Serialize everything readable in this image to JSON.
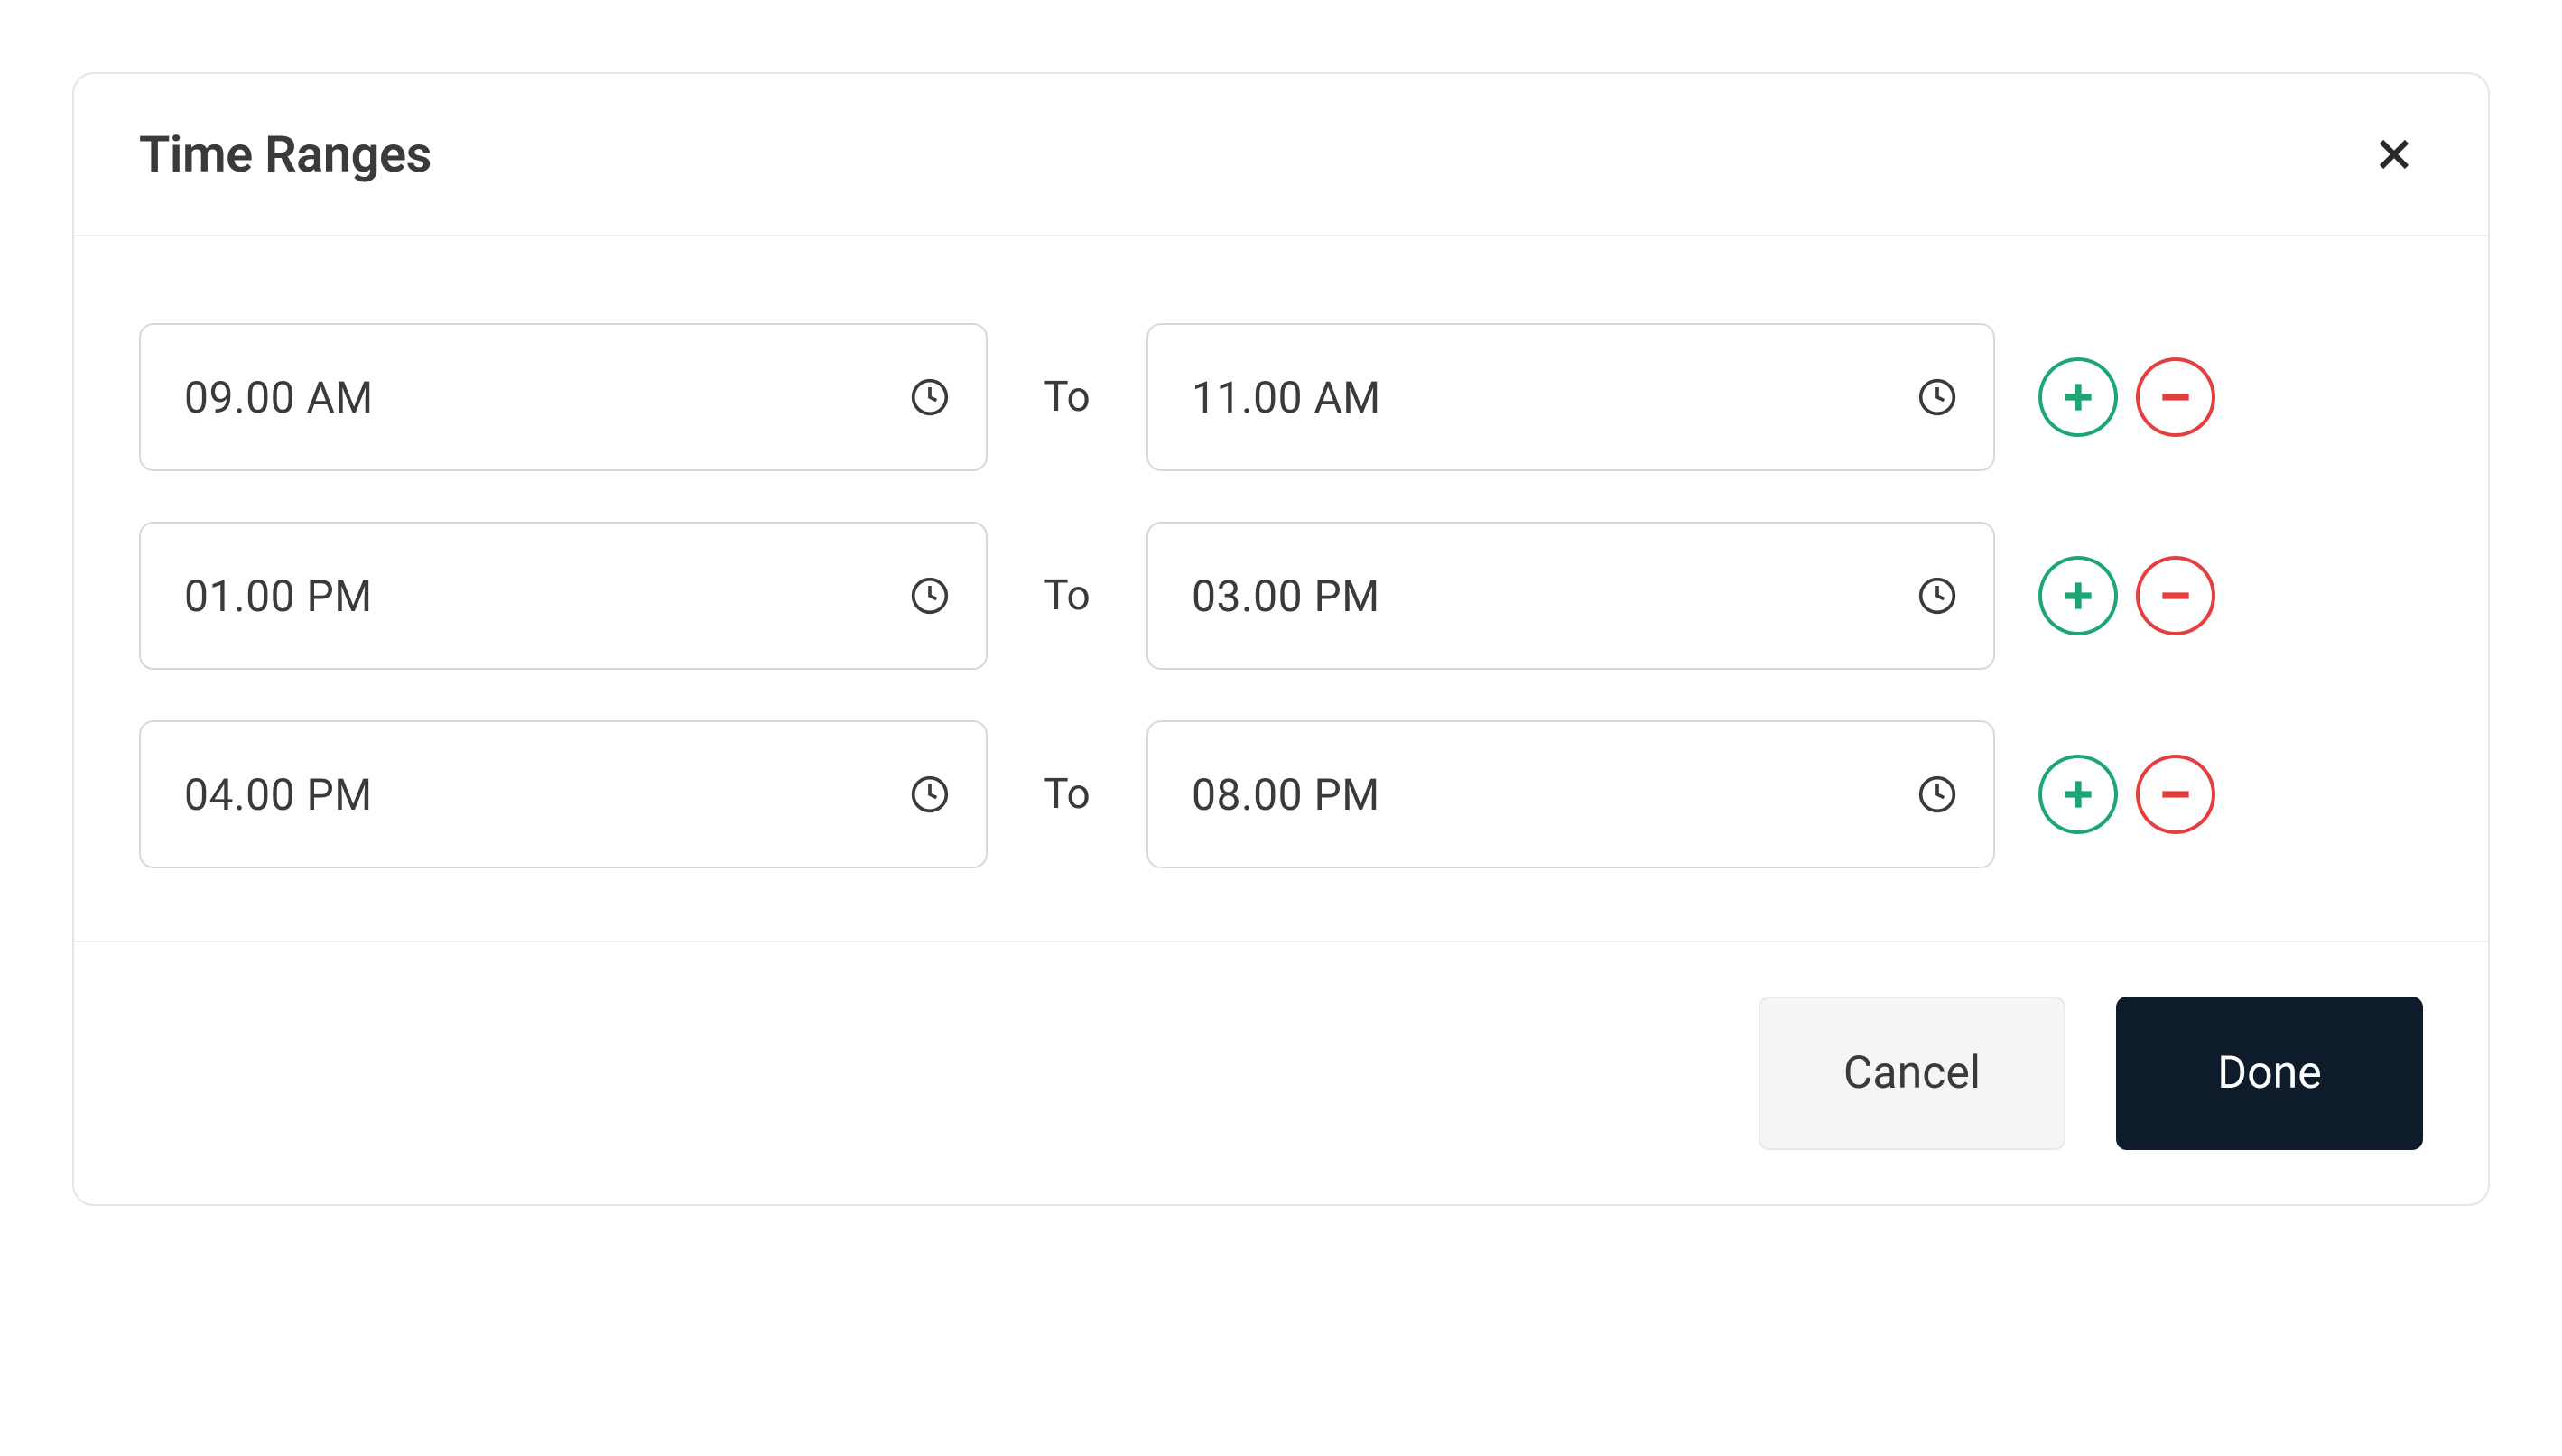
{
  "modal": {
    "title": "Time Ranges",
    "to_label": "To",
    "ranges": [
      {
        "from": "09.00 AM",
        "to": "11.00 AM"
      },
      {
        "from": "01.00 PM",
        "to": "03.00 PM"
      },
      {
        "from": "04.00 PM",
        "to": "08.00 PM"
      }
    ],
    "footer": {
      "cancel_label": "Cancel",
      "done_label": "Done"
    }
  }
}
